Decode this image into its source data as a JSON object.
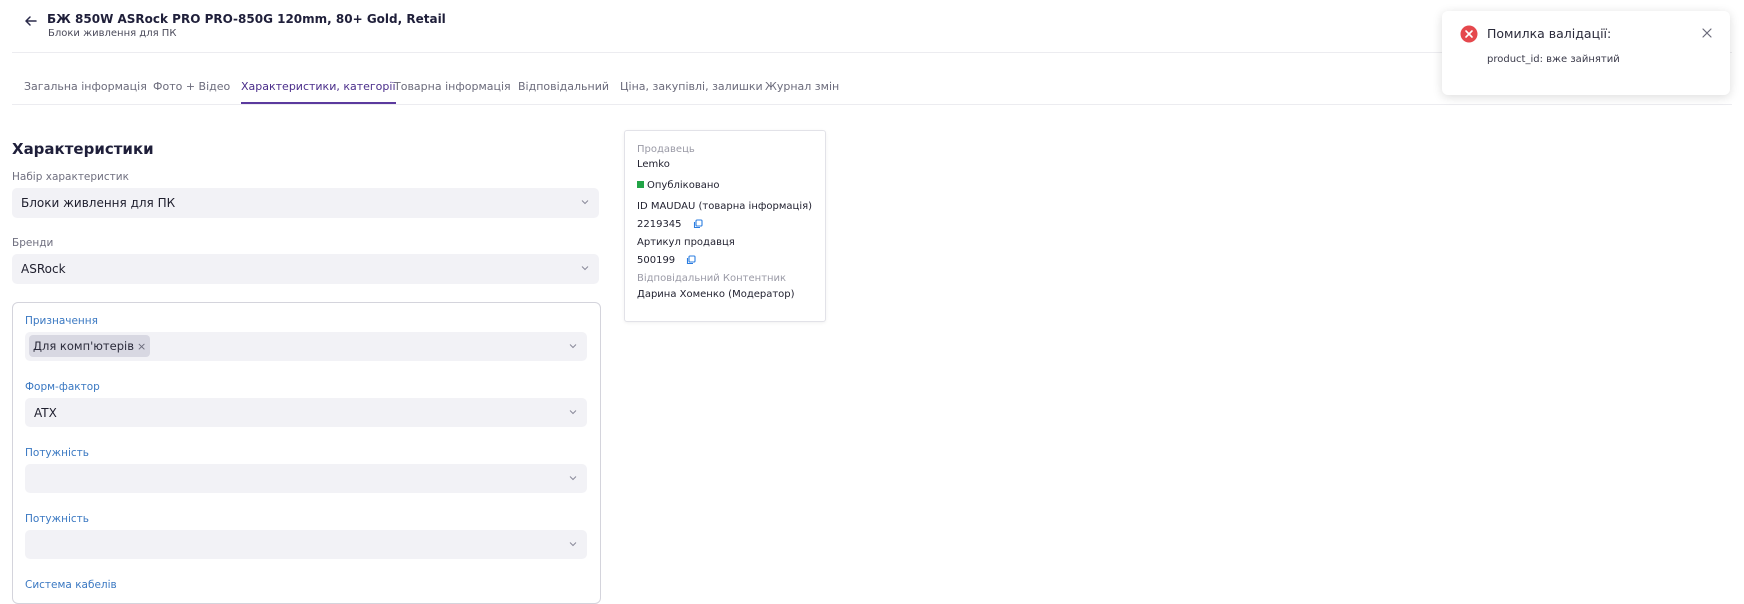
{
  "header": {
    "title": "БЖ 850W ASRock PRO PRO-850G 120mm, 80+ Gold, Retail",
    "subtitle": "Блоки живлення для ПК",
    "back_icon": "arrow-left-icon"
  },
  "tabs": [
    {
      "label": "Загальна інформація"
    },
    {
      "label": "Фото + Відео"
    },
    {
      "label": "Характеристики, категорії",
      "active": true
    },
    {
      "label": "Товарна інформація"
    },
    {
      "label": "Відповідальний"
    },
    {
      "label": "Ціна, закупівлі, залишки"
    },
    {
      "label": "Журнал змін"
    }
  ],
  "characteristics": {
    "section_title": "Характеристики",
    "set_label": "Набір характеристик",
    "set_value": "Блоки живлення для ПК",
    "brands_label": "Бренди",
    "brands_value": "ASRock",
    "fields": [
      {
        "label": "Призначення",
        "chip": "Для комп'ютерів"
      },
      {
        "label": "Форм-фактор",
        "value": "ATX"
      },
      {
        "label": "Потужність",
        "value": ""
      },
      {
        "label": "Потужність",
        "value": ""
      },
      {
        "label": "Система кабелів"
      }
    ]
  },
  "info_card": {
    "seller_label": "Продавець",
    "seller_value": "Lemko",
    "status": "Опубліковано",
    "maudau_label": "ID MAUDAU (товарна інформація)",
    "maudau_value": "2219345",
    "article_label": "Артикул продавця",
    "article_value": "500199",
    "content_label": "Відповідальний Контентник",
    "content_value": "Дарина Хоменко (Модератор)"
  },
  "toast": {
    "title": "Помилка валідації:",
    "message": "product_id: вже зайнятий"
  },
  "colors": {
    "accent": "#5b3a9e",
    "link_blue": "#3a78c2",
    "error": "#e5484d",
    "status_green": "#22a447"
  }
}
